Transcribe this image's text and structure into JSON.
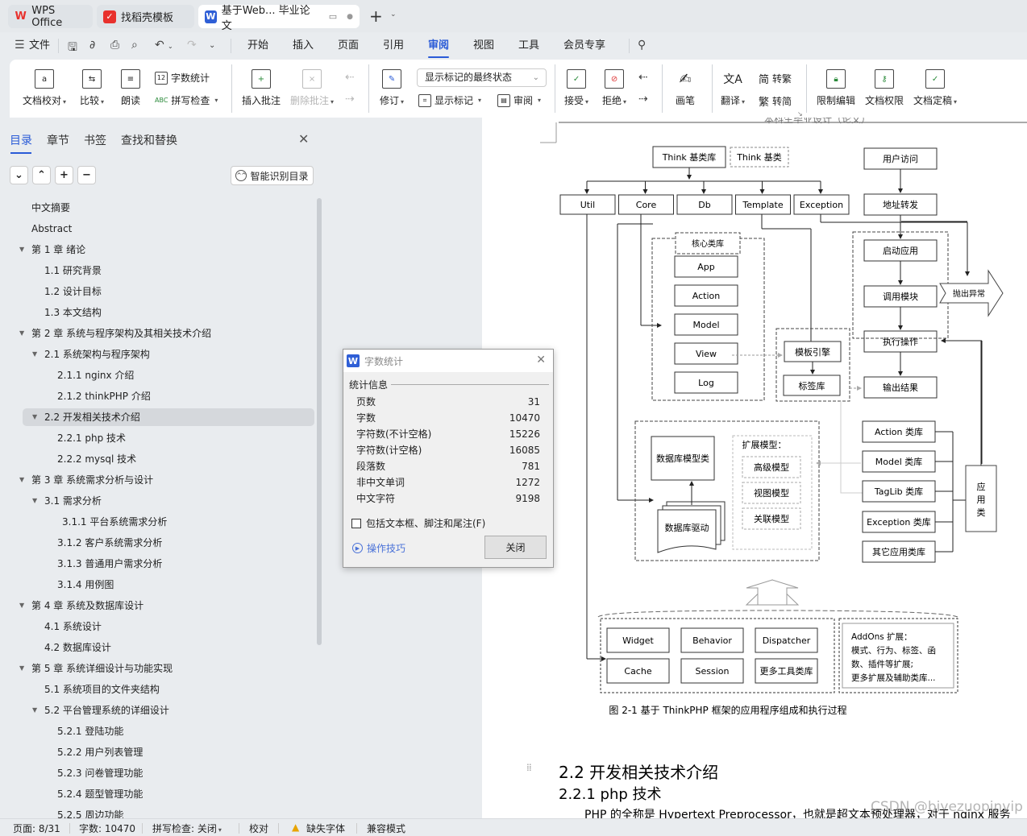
{
  "tabs": [
    {
      "label": "WPS Office",
      "icon": "wps-logo-icon"
    },
    {
      "label": "找稻壳模板",
      "icon": "docer-icon"
    },
    {
      "label": "基于Web... 毕业论文",
      "icon": "writer-icon",
      "active": true
    }
  ],
  "menu": {
    "file": "文件",
    "items": [
      "开始",
      "插入",
      "页面",
      "引用",
      "审阅",
      "视图",
      "工具",
      "会员专享"
    ],
    "active": "审阅"
  },
  "ribbon": {
    "doc_check": "文档校对",
    "compare": "比较",
    "read_aloud": "朗读",
    "word_count": "字数统计",
    "spell_check": "拼写检查",
    "insert_comment": "插入批注",
    "delete_comment": "删除批注",
    "revise": "修订",
    "markup_state": "显示标记的最终状态",
    "show_markup": "显示标记",
    "review": "审阅",
    "accept": "接受",
    "reject": "拒绝",
    "pen": "画笔",
    "translate": "翻译",
    "to_traditional": "转繁",
    "to_simplified": "转简",
    "restrict_edit": "限制编辑",
    "doc_permission": "文档权限",
    "doc_finalize": "文档定稿"
  },
  "sidebar": {
    "tabs": [
      "目录",
      "章节",
      "书签",
      "查找和替换"
    ],
    "active_tab": "目录",
    "ai_toc": "智能识别目录",
    "toc": [
      {
        "label": "中文摘要",
        "level": 0,
        "expander": false
      },
      {
        "label": "Abstract",
        "level": 0,
        "expander": false
      },
      {
        "label": "第 1 章  绪论",
        "level": 0,
        "expander": true
      },
      {
        "label": "1.1     研究背景",
        "level": 1,
        "expander": false
      },
      {
        "label": "1.2  设计目标",
        "level": 1,
        "expander": false
      },
      {
        "label": "1.3 本文结构",
        "level": 1,
        "expander": false
      },
      {
        "label": "第 2 章  系统与程序架构及其相关技术介绍",
        "level": 0,
        "expander": true
      },
      {
        "label": "2.1  系统架构与程序架构",
        "level": 1,
        "expander": true
      },
      {
        "label": "2.1.1  nginx 介绍",
        "level": 2,
        "expander": false
      },
      {
        "label": "2.1.2  thinkPHP 介绍",
        "level": 2,
        "expander": false
      },
      {
        "label": "2.2  开发相关技术介绍",
        "level": 1,
        "expander": true,
        "selected": true
      },
      {
        "label": "2.2.1  php 技术",
        "level": 2,
        "expander": false
      },
      {
        "label": "2.2.2  mysql 技术",
        "level": 2,
        "expander": false
      },
      {
        "label": "第 3 章  系统需求分析与设计",
        "level": 0,
        "expander": true
      },
      {
        "label": "3.1  需求分析",
        "level": 1,
        "expander": true
      },
      {
        "label": "3.1.1  平台系统需求分析",
        "level": 3,
        "expander": false
      },
      {
        "label": "3.1.2  客户系统需求分析",
        "level": 2,
        "expander": false
      },
      {
        "label": "3.1.3  普通用户需求分析",
        "level": 2,
        "expander": false
      },
      {
        "label": "3.1.4  用例图",
        "level": 2,
        "expander": false
      },
      {
        "label": "第 4 章  系统及数据库设计",
        "level": 0,
        "expander": true
      },
      {
        "label": "4.1  系统设计",
        "level": 1,
        "expander": false
      },
      {
        "label": "4.2 数据库设计",
        "level": 1,
        "expander": false
      },
      {
        "label": "第 5 章  系统详细设计与功能实现",
        "level": 0,
        "expander": true
      },
      {
        "label": "5.1    系统项目的文件夹结构",
        "level": 1,
        "expander": false
      },
      {
        "label": "5.2 平台管理系统的详细设计",
        "level": 1,
        "expander": true
      },
      {
        "label": "5.2.1 登陆功能",
        "level": 2,
        "expander": false
      },
      {
        "label": "5.2.2  用户列表管理",
        "level": 2,
        "expander": false
      },
      {
        "label": "5.2.3  问卷管理功能",
        "level": 2,
        "expander": false
      },
      {
        "label": "5.2.4  题型管理功能",
        "level": 2,
        "expander": false
      },
      {
        "label": "5.2.5  周边功能",
        "level": 2,
        "expander": false
      }
    ]
  },
  "dialog": {
    "title": "字数统计",
    "section": "统计信息",
    "rows": [
      {
        "label": "页数",
        "value": "31"
      },
      {
        "label": "字数",
        "value": "10470"
      },
      {
        "label": "字符数(不计空格)",
        "value": "15226"
      },
      {
        "label": "字符数(计空格)",
        "value": "16085"
      },
      {
        "label": "段落数",
        "value": "781"
      },
      {
        "label": "非中文单词",
        "value": "1272"
      },
      {
        "label": "中文字符",
        "value": "9198"
      }
    ],
    "checkbox": "包括文本框、脚注和尾注(F)",
    "checkbox_checked": false,
    "tips": "操作技巧",
    "close": "关闭"
  },
  "document": {
    "header_text": "本科生毕业设计（论文）",
    "diagram": {
      "think_lib": "Think 基类库",
      "think_base": "Think 基类",
      "top_modules": [
        "Util",
        "Core",
        "Db",
        "Template",
        "Exception"
      ],
      "core_lib_title": "核心类库",
      "core_items": [
        "App",
        "Action",
        "Model",
        "View",
        "Log"
      ],
      "template_engine": "模板引擎",
      "tag_lib": "标签库",
      "flow": [
        "用户访问",
        "地址转发",
        "启动应用",
        "调用模块",
        "执行操作",
        "输出结果"
      ],
      "throw_exception": "抛出异常",
      "db_model": "数据库模型类",
      "db_driver": "数据库驱动",
      "ext_model_title": "扩展模型：",
      "ext_models": [
        "高级模型",
        "视图模型",
        "关联模型"
      ],
      "app_libs": [
        "Action 类库",
        "Model 类库",
        "TagLib 类库",
        "Exception 类库",
        "其它应用类库"
      ],
      "app_class": "应用类",
      "tools": [
        "Widget",
        "Behavior",
        "Dispatcher",
        "Cache",
        "Session",
        "更多工具类库"
      ],
      "addons": [
        "AddOns 扩展：",
        "模式、行为、标签、函",
        "数、插件等扩展;",
        "更多扩展及辅助类库..."
      ]
    },
    "caption": "图 2-1  基于 ThinkPHP 框架的应用程序组成和执行过程",
    "heading2": "2.2  开发相关技术介绍",
    "heading3": "2.2.1  php 技术",
    "body": "PHP 的全称是 Hypertext Preprocessor，也就是超文本预处理器，对于 nginx 服务"
  },
  "status": {
    "page": "页面: 8/31",
    "words": "字数: 10470",
    "spell": "拼写检查: 关闭",
    "proof": "校对",
    "missing_font": "缺失字体",
    "compat": "兼容模式"
  },
  "watermark": "CSDN @biyezuopinvip",
  "colors": {
    "accent": "#2a5bd7",
    "wps_red": "#e8312d",
    "writer_blue": "#2f5fd6"
  }
}
